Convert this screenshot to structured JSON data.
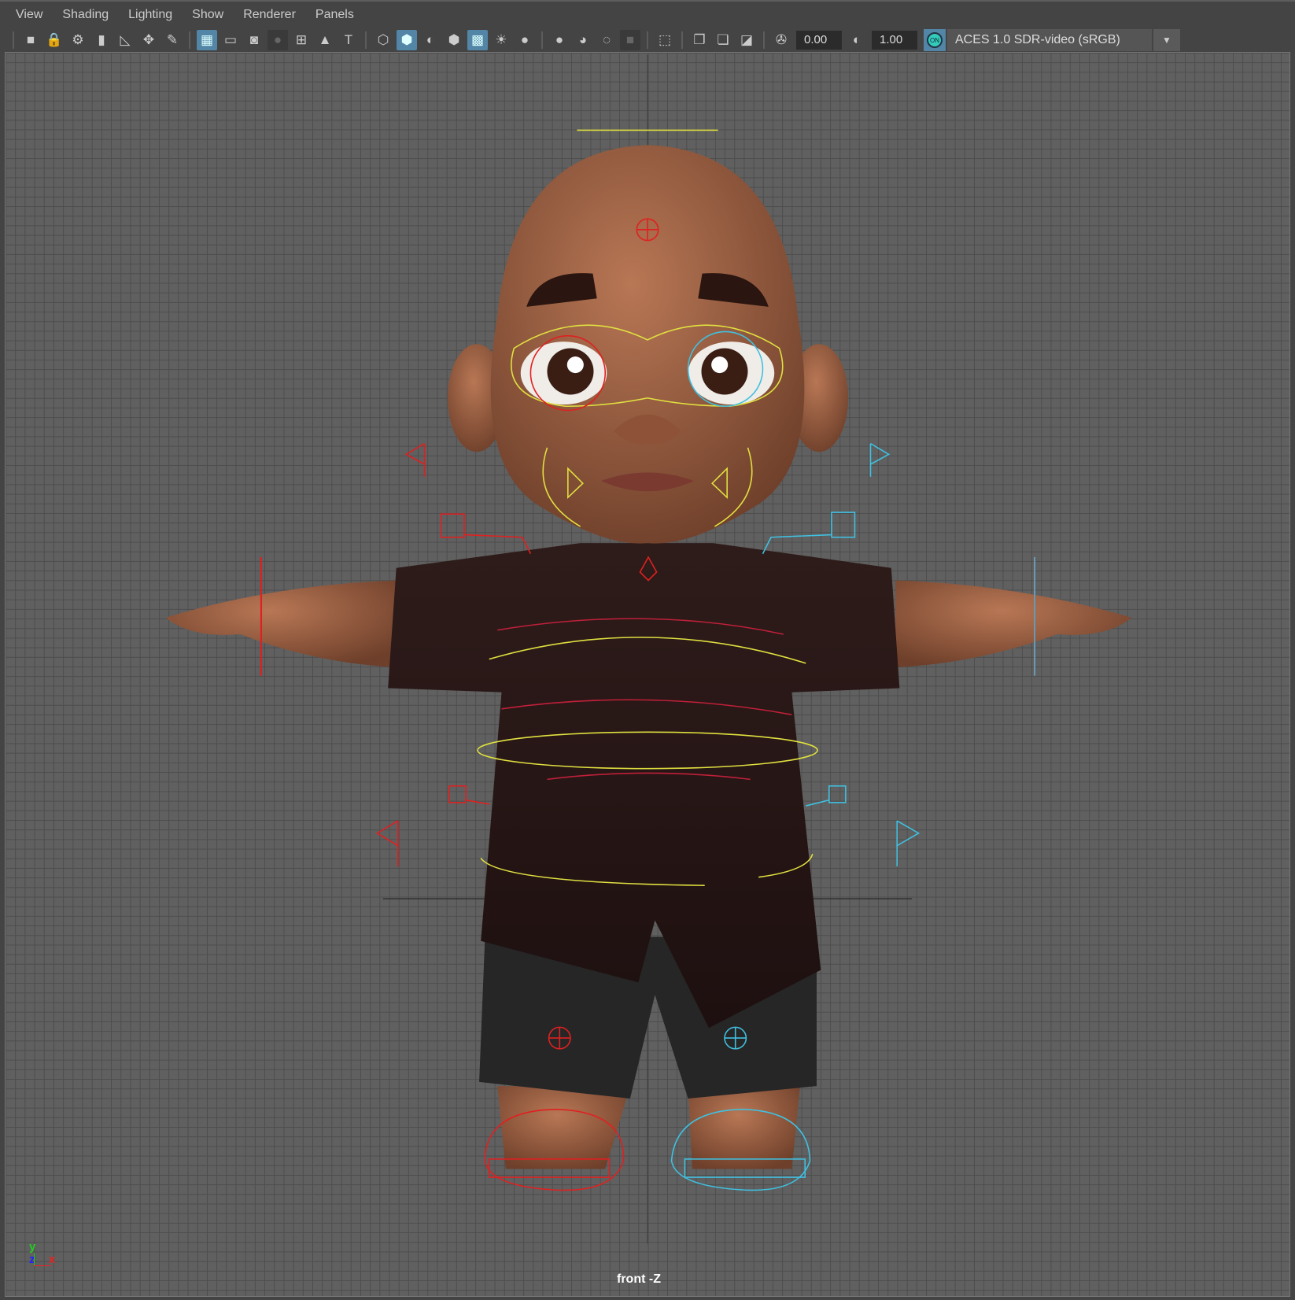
{
  "menu": [
    "View",
    "Shading",
    "Lighting",
    "Show",
    "Renderer",
    "Panels"
  ],
  "toolbar": {
    "groups": [
      [
        "camera-icon",
        "lock-camera-icon",
        "camera-attributes-icon",
        "bookmark-icon",
        "image-plane-icon",
        "2d-pan-zoom-icon",
        "grease-pencil-icon"
      ],
      [
        "grid-icon",
        "film-gate-icon",
        "resolution-gate-icon",
        "gate-mask-icon",
        "field-chart-icon",
        "safe-action-icon",
        "safe-title-icon"
      ],
      [
        "wireframe-icon",
        "smooth-shade-icon",
        "default-material-icon",
        "wireframe-on-shaded-icon",
        "textured-icon",
        "use-all-lights-icon",
        "shadows-icon"
      ],
      [
        "screen-space-ao-icon",
        "motion-blur-icon",
        "anti-aliasing-icon",
        "depth-of-field-icon"
      ],
      [
        "select-camera-icon"
      ],
      [
        "isolate-select-icon",
        "xray-icon",
        "xray-joints-icon"
      ]
    ],
    "active": [
      "grid-icon",
      "smooth-shade-icon",
      "textured-icon"
    ],
    "exposure_value": "0.00",
    "gamma_value": "1.00",
    "color_management_label": "ON",
    "color_space": "ACES 1.0 SDR-video (sRGB)"
  },
  "viewport": {
    "camera_label": "front -Z",
    "axis": {
      "y": "y",
      "z": "z",
      "x": "x"
    }
  },
  "colors": {
    "accent": "#5285a6",
    "left_controls": "#e02020",
    "right_controls": "#40c0e0",
    "center_controls": "#e0e040",
    "skin": "#a8694a",
    "shirt": "#2a1816",
    "shorts": "#262626"
  }
}
